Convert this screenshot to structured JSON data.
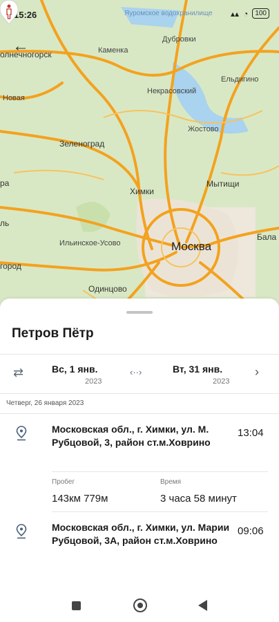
{
  "status_bar": {
    "time": "15:26",
    "battery": "100",
    "top_label": "Яуромское водохранилище"
  },
  "map": {
    "labels": [
      {
        "name": "solnechnogorsk",
        "text": "олнечногорск"
      },
      {
        "name": "kamenka",
        "text": "Каменка"
      },
      {
        "name": "dubrovki",
        "text": "Дубровки"
      },
      {
        "name": "nekrasovsky",
        "text": "Некрасовский"
      },
      {
        "name": "eldigino",
        "text": "Ельдигино"
      },
      {
        "name": "novaya",
        "text": "Новая"
      },
      {
        "name": "zhostovo",
        "text": "Жостово"
      },
      {
        "name": "zelenograd",
        "text": "Зеленоград"
      },
      {
        "name": "khimki",
        "text": "Химки"
      },
      {
        "name": "mytishchi",
        "text": "Мытищи"
      },
      {
        "name": "ra",
        "text": "ра"
      },
      {
        "name": "il",
        "text": "ль"
      },
      {
        "name": "ilinskoe",
        "text": "Ильинское-Усово"
      },
      {
        "name": "moskva",
        "text": "Москва"
      },
      {
        "name": "bala",
        "text": "Бала"
      },
      {
        "name": "gorod",
        "text": "город"
      },
      {
        "name": "odintsovo",
        "text": "Одинцово"
      }
    ]
  },
  "sheet": {
    "person_name": "Петров Пётр",
    "date_from": {
      "label": "Вс, 1 янв.",
      "year": "2023"
    },
    "date_to": {
      "label": "Вт, 31 янв.",
      "year": "2023"
    },
    "day_header": "Четверг, 26 января 2023",
    "entries": [
      {
        "address": "Московская обл., г. Химки, ул. М. Рубцовой, 3, район ст.м.Ховрино",
        "time": "13:04"
      },
      {
        "address": "Московская обл., г. Химки, ул. Марии Рубцовой, 3А, район ст.м.Ховрино",
        "time": "09:06"
      }
    ],
    "stats": {
      "mileage_label": "Пробег",
      "mileage_value": "143км 779м",
      "time_label": "Время",
      "time_value": "3 часа 58 минут"
    }
  }
}
